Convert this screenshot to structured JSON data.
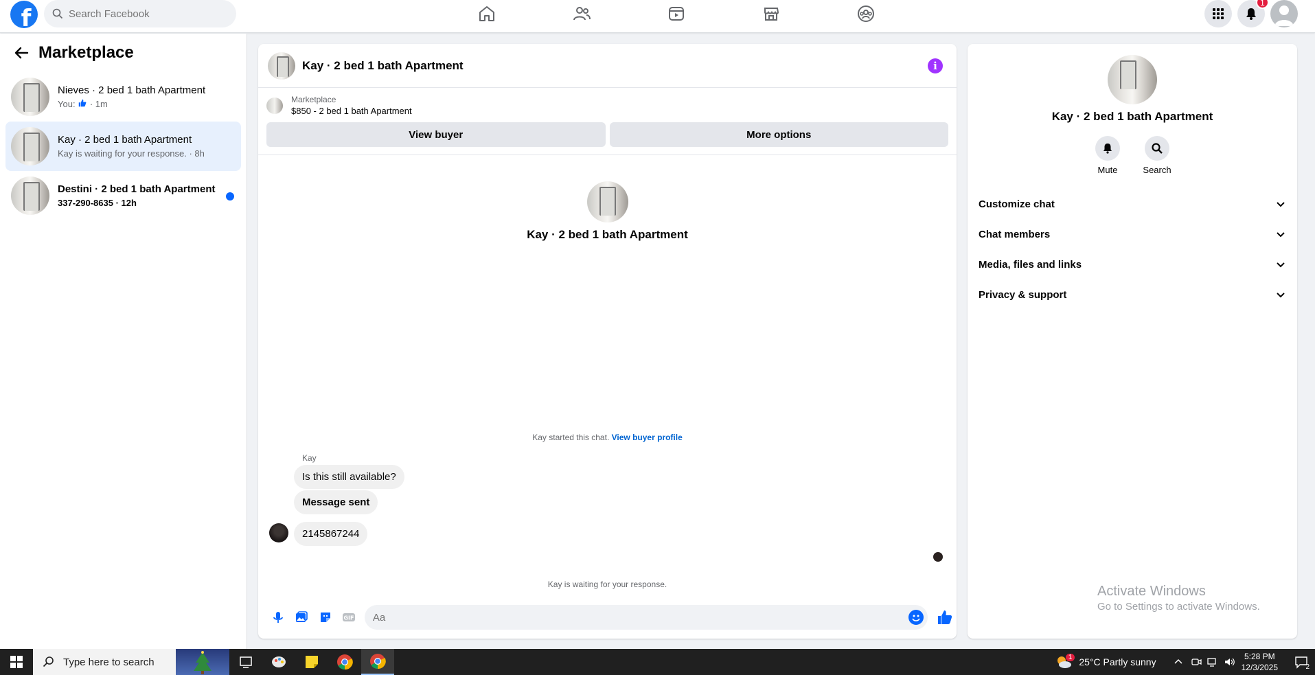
{
  "topbar": {
    "search_placeholder": "Search Facebook",
    "notification_count": "1",
    "logo_letter": "f"
  },
  "sidebar": {
    "title": "Marketplace",
    "conversations": [
      {
        "title": "Nieves · 2 bed 1 bath Apartment",
        "sub_prefix": "You:",
        "sub_suffix": "· 1m",
        "active": false,
        "unread": false
      },
      {
        "title": "Kay · 2 bed 1 bath Apartment",
        "sub": "Kay is waiting for your response. · 8h",
        "active": true,
        "unread": false
      },
      {
        "title": "Destini · 2 bed 1 bath Apartment",
        "sub": "337-290-8635 · 12h",
        "active": false,
        "unread": true
      }
    ]
  },
  "chat": {
    "header_title": "Kay · 2 bed 1 bath Apartment",
    "info_glyph": "i",
    "marketplace_label": "Marketplace",
    "listing": "$850 - 2 bed 1 bath Apartment",
    "view_buyer_label": "View buyer",
    "more_options_label": "More options",
    "intro_title": "Kay · 2 bed 1 bath Apartment",
    "started_text": "Kay started this chat.",
    "view_buyer_profile_link": "View buyer profile",
    "sender_name": "Kay",
    "messages": [
      {
        "text": "Is this still available?"
      },
      {
        "text": "Message sent"
      },
      {
        "text": "2145867244"
      }
    ],
    "waiting_text": "Kay is waiting for your response.",
    "composer_placeholder": "Aa"
  },
  "info_panel": {
    "title": "Kay · 2 bed 1 bath Apartment",
    "mute_label": "Mute",
    "search_label": "Search",
    "sections": [
      "Customize chat",
      "Chat members",
      "Media, files and links",
      "Privacy & support"
    ],
    "activate_title": "Activate Windows",
    "activate_sub": "Go to Settings to activate Windows."
  },
  "taskbar": {
    "search_placeholder": "Type here to search",
    "weather": "25°C  Partly sunny",
    "weather_badge": "1",
    "time": "5:28 PM",
    "date": "12/3/2025",
    "notification_count": "2"
  },
  "colors": {
    "brand": "#1877f2",
    "active_conv": "#e7f0fd",
    "unread_dot": "#0866ff",
    "link": "#0064d1",
    "info_accent": "#a033ff"
  }
}
